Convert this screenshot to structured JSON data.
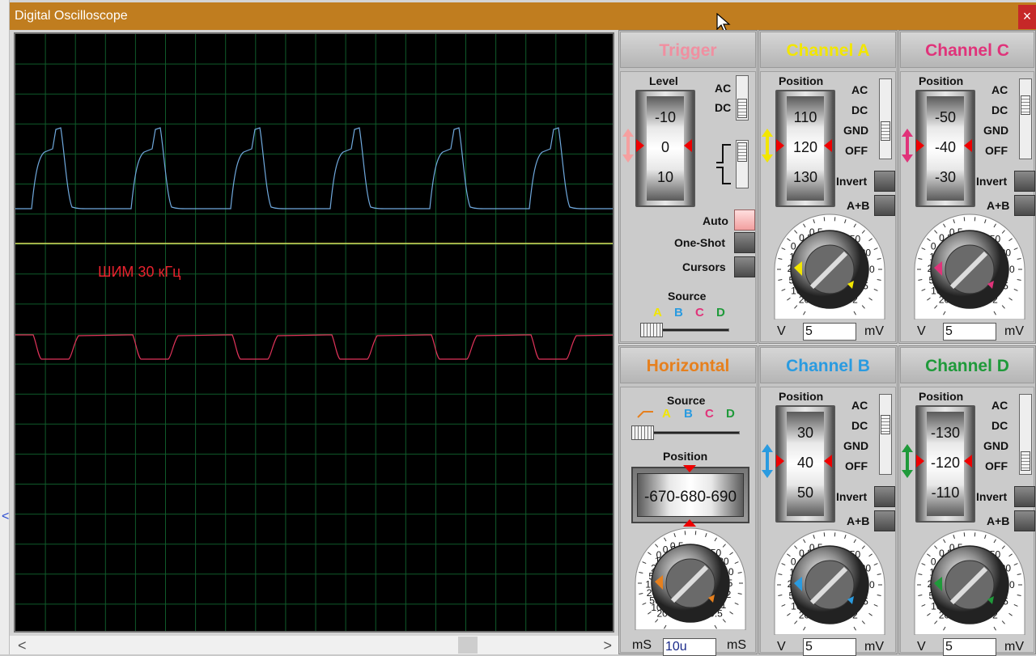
{
  "window": {
    "title": "Digital Oscilloscope",
    "close": "×"
  },
  "screen": {
    "label": "ШИМ 30 кГц",
    "trace_a_color": "#6fa8dc",
    "trace_b_color": "#ffff66",
    "trace_c_color": "#e0335a",
    "grid_color": "#0f5a2a"
  },
  "trigger": {
    "title": "Trigger",
    "title_color": "#f08fa0",
    "level_label": "Level",
    "drum_values": [
      "-10",
      "0",
      "10"
    ],
    "ac": "AC",
    "dc": "DC",
    "auto": "Auto",
    "one_shot": "One-Shot",
    "cursors": "Cursors",
    "source_label": "Source",
    "source_letters": [
      "A",
      "B",
      "C",
      "D"
    ]
  },
  "channel_a": {
    "title": "Channel A",
    "title_color": "#f2e600",
    "position_label": "Position",
    "drum_values": [
      "110",
      "120",
      "130"
    ],
    "coupling": [
      "AC",
      "DC",
      "GND",
      "OFF"
    ],
    "invert": "Invert",
    "aplusb": "A+B",
    "scale_left": [
      "0.5",
      "0.2",
      "0.1",
      "1",
      "2",
      "5",
      "10",
      "20"
    ],
    "scale_right": [
      "50",
      "20",
      "10",
      "5",
      "2"
    ],
    "v_unit": "V",
    "mv_unit": "mV",
    "value": "5",
    "arrow_color": "#f2e600"
  },
  "channel_c": {
    "title": "Channel C",
    "title_color": "#e0337a",
    "position_label": "Position",
    "drum_values": [
      "-50",
      "-40",
      "-30"
    ],
    "coupling": [
      "AC",
      "DC",
      "GND",
      "OFF"
    ],
    "invert": "Invert",
    "aplusb": "A+B",
    "scale_left": [
      "0.5",
      "0.2",
      "0.1",
      "1",
      "2",
      "5",
      "10",
      "20"
    ],
    "scale_right": [
      "50",
      "20",
      "10",
      "5",
      "2"
    ],
    "v_unit": "V",
    "mv_unit": "mV",
    "value": "5",
    "arrow_color": "#e0337a"
  },
  "horizontal": {
    "title": "Horizontal",
    "title_color": "#e6801e",
    "source_label": "Source",
    "source_letters": [
      "A",
      "B",
      "C",
      "D"
    ],
    "position_label": "Position",
    "position_value": "-670-680-690",
    "scale_left": [
      "0.5",
      "0.2",
      "0.1",
      "1",
      "2",
      "5",
      "10",
      "20",
      "50",
      "100",
      "200"
    ],
    "scale_right": [
      "50",
      "20",
      "10",
      "5",
      "2",
      "1",
      "0.5"
    ],
    "ms_left": "mS",
    "ms_right": "mS",
    "value": "10u",
    "arrow_color": "#e6801e"
  },
  "channel_b": {
    "title": "Channel B",
    "title_color": "#2a9be0",
    "position_label": "Position",
    "drum_values": [
      "30",
      "40",
      "50"
    ],
    "coupling": [
      "AC",
      "DC",
      "GND",
      "OFF"
    ],
    "invert": "Invert",
    "aplusb": "A+B",
    "scale_left": [
      "0.5",
      "0.2",
      "0.1",
      "1",
      "2",
      "5",
      "10",
      "20"
    ],
    "scale_right": [
      "50",
      "20",
      "10",
      "5",
      "2"
    ],
    "v_unit": "V",
    "mv_unit": "mV",
    "value": "5",
    "arrow_color": "#2a9be0"
  },
  "channel_d": {
    "title": "Channel D",
    "title_color": "#1f9a3a",
    "position_label": "Position",
    "drum_values": [
      "-130",
      "-120",
      "-110"
    ],
    "coupling": [
      "AC",
      "DC",
      "GND",
      "OFF"
    ],
    "invert": "Invert",
    "aplusb": "A+B",
    "scale_left": [
      "0.5",
      "0.2",
      "0.1",
      "1",
      "2",
      "5",
      "10",
      "20"
    ],
    "scale_right": [
      "50",
      "20",
      "10",
      "5",
      "2"
    ],
    "v_unit": "V",
    "mv_unit": "mV",
    "value": "5",
    "arrow_color": "#1f9a3a"
  },
  "scroll": {
    "left": "<",
    "right": ">"
  }
}
